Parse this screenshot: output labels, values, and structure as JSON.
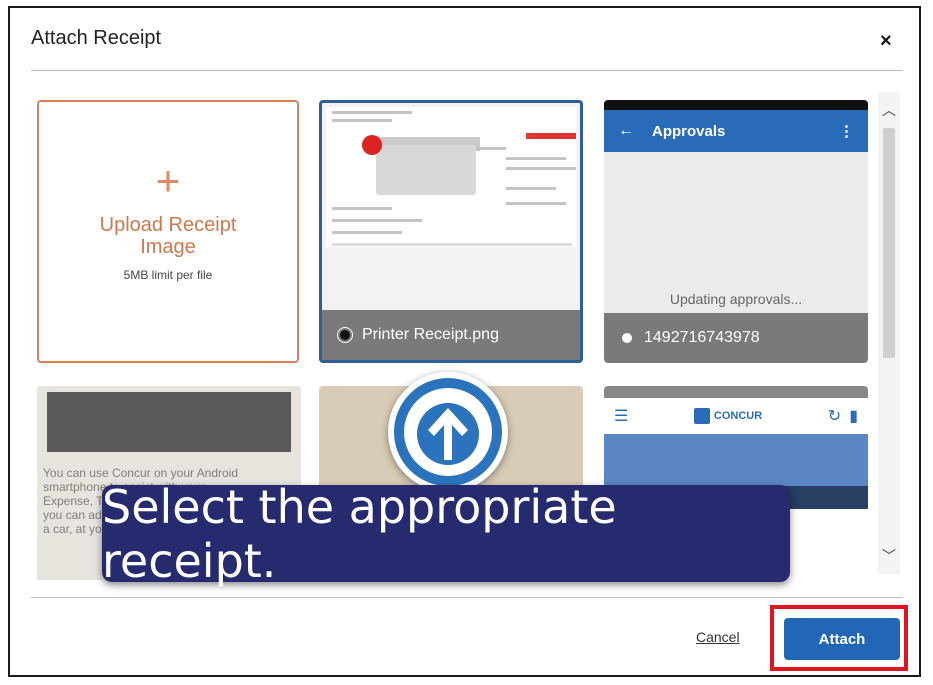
{
  "dialog": {
    "title": "Attach Receipt",
    "close_label": "×"
  },
  "upload_tile": {
    "plus": "+",
    "label": "Upload Receipt Image",
    "limit": "5MB limit per file"
  },
  "receipts": [
    {
      "caption": "Printer Receipt.png",
      "selected": true
    },
    {
      "caption": "1492716743978",
      "selected": false,
      "app_title": "Approvals",
      "status": "Updating approvals..."
    }
  ],
  "concur_thumb": {
    "logo_text": "CONCUR"
  },
  "doc_thumb": {
    "text": "You can use Concur on your Android smartphone to assist with your Expense, Travel, Invoice... because you can add receipts in a meeting, in a car, at your laptop..."
  },
  "footer": {
    "cancel_label": "Cancel",
    "attach_label": "Attach"
  },
  "overlay": {
    "instruction": "Select the appropriate receipt."
  },
  "colors": {
    "accent_blue": "#2167b6",
    "upload_orange": "#d9825a",
    "banner_navy": "#262a6e",
    "highlight_red": "#e0141e"
  }
}
